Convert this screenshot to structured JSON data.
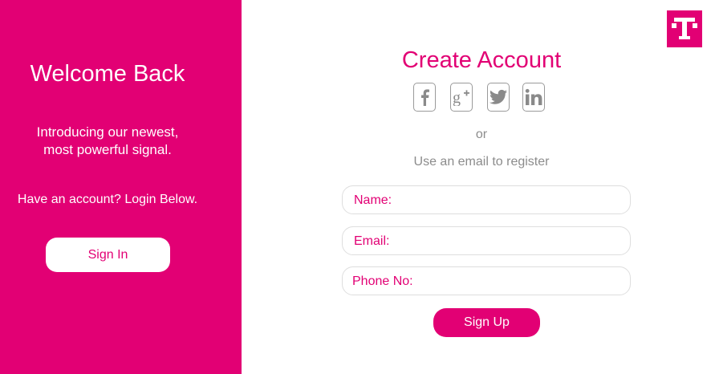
{
  "colors": {
    "brand": "#e20074",
    "muted": "#8c8c8c",
    "icon_border": "#9a9a9a"
  },
  "left_panel": {
    "title": "Welcome Back",
    "tagline_line1": "Introducing our newest,",
    "tagline_line2": "most powerful signal.",
    "have_account": "Have an account? Login Below.",
    "sign_in_label": "Sign In"
  },
  "logo": {
    "icon": "t-logo-icon"
  },
  "right_panel": {
    "title": "Create Account",
    "social": [
      {
        "name": "facebook",
        "icon": "facebook-icon",
        "glyph": "f"
      },
      {
        "name": "google-plus",
        "icon": "google-plus-icon",
        "glyph": "g+"
      },
      {
        "name": "twitter",
        "icon": "twitter-icon",
        "glyph": "bird"
      },
      {
        "name": "linkedin",
        "icon": "linkedin-icon",
        "glyph": "in"
      }
    ],
    "or_text": "or",
    "email_hint": "Use an email to register",
    "fields": [
      {
        "label": "Name:",
        "value": "",
        "placeholder": ""
      },
      {
        "label": "Email:",
        "value": "",
        "placeholder": ""
      },
      {
        "label": "Phone No:",
        "value": "",
        "placeholder": ""
      }
    ],
    "sign_up_label": "Sign Up"
  }
}
